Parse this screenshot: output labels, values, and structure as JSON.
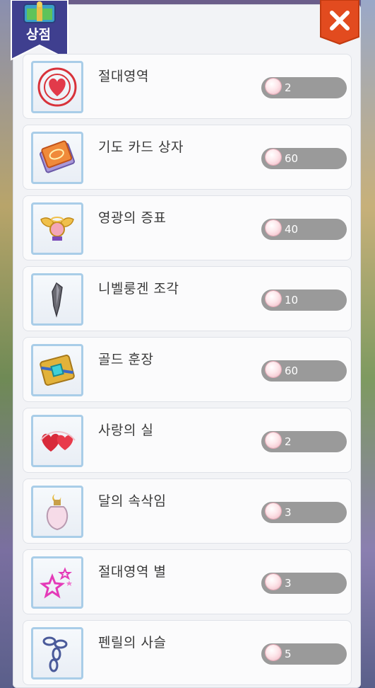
{
  "shop": {
    "title": "상점",
    "close_symbol": "✕",
    "items": [
      {
        "name": "절대영역",
        "price": "2",
        "icon": "heart-target-icon"
      },
      {
        "name": "기도 카드 상자",
        "price": "60",
        "icon": "prayer-card-box-icon"
      },
      {
        "name": "영광의 증표",
        "price": "40",
        "icon": "winged-emblem-icon"
      },
      {
        "name": "니벨룽겐 조각",
        "price": "10",
        "icon": "shard-icon"
      },
      {
        "name": "골드 훈장",
        "price": "60",
        "icon": "gold-medal-icon"
      },
      {
        "name": "사랑의 실",
        "price": "2",
        "icon": "heart-thread-icon"
      },
      {
        "name": "달의 속삭임",
        "price": "3",
        "icon": "moon-bottle-icon"
      },
      {
        "name": "절대영역 별",
        "price": "3",
        "icon": "star-icon"
      },
      {
        "name": "펜릴의 사슬",
        "price": "5",
        "icon": "chain-icon"
      }
    ]
  }
}
